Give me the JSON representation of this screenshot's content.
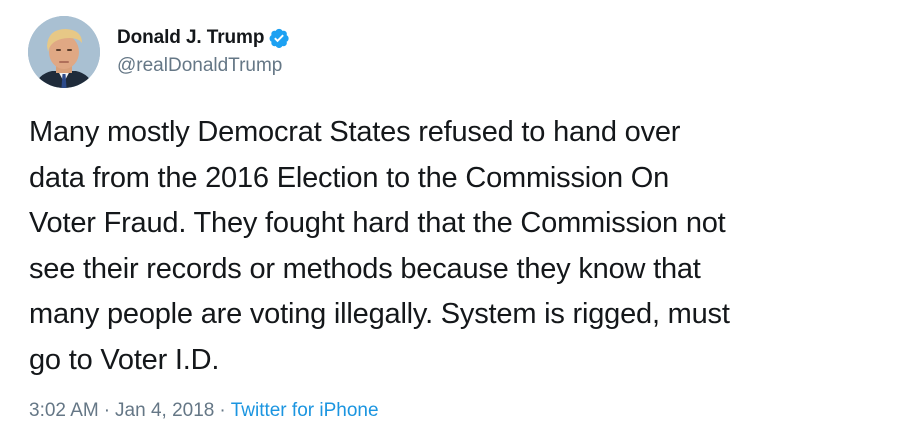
{
  "tweet": {
    "author": {
      "display_name": "Donald J. Trump",
      "handle": "@realDonaldTrump",
      "verified_icon": "verified-badge-icon",
      "verified_color": "#1da1f2"
    },
    "text": "Many mostly Democrat States refused to hand over\ndata from the 2016 Election to the Commission On\nVoter Fraud. They fought hard that the Commission not\nsee their records or methods because they know that\nmany people are voting illegally. System is rigged, must\ngo to Voter I.D.",
    "time": "3:02 AM",
    "separator": "·",
    "date": "Jan 4, 2018",
    "source": "Twitter for iPhone",
    "source_color": "#1b95e0"
  }
}
